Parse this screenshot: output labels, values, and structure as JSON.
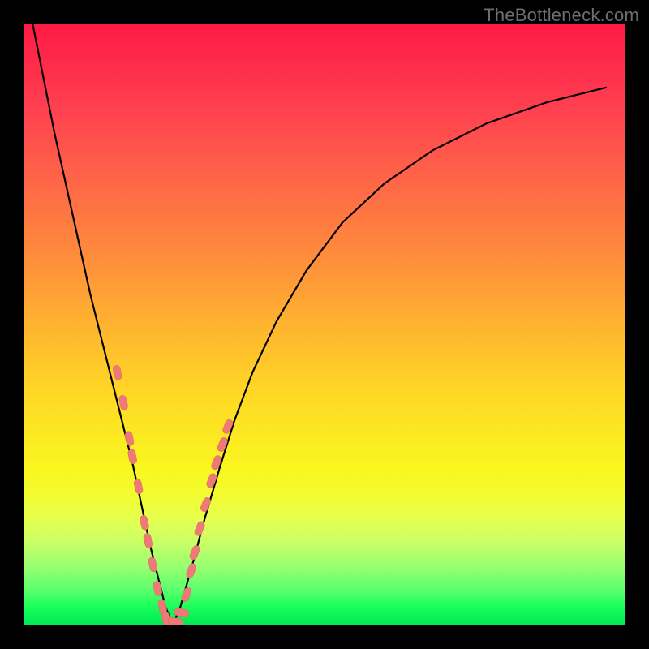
{
  "watermark": "TheBottleneck.com",
  "colors": {
    "background": "#000000",
    "gradient_top": "#ff1a45",
    "gradient_bottom": "#00e854",
    "curve": "#000000",
    "bead_fill": "#ee7a77",
    "bead_stroke": "#e06865"
  },
  "chart_data": {
    "type": "line",
    "title": "",
    "xlabel": "",
    "ylabel": "",
    "xlim": [
      0,
      100
    ],
    "ylim": [
      0,
      100
    ],
    "grid": false,
    "series": [
      {
        "name": "curve",
        "x": [
          1,
          3,
          5,
          7,
          9,
          11,
          13,
          15,
          16.5,
          18,
          19.5,
          21,
          22.25,
          23.5,
          24.75,
          26,
          28,
          30,
          32.5,
          35,
          38,
          42,
          47,
          53,
          60,
          68,
          77,
          87,
          97
        ],
        "values": [
          102,
          92,
          82,
          73,
          64,
          55,
          47,
          39,
          33,
          27,
          20,
          13,
          8,
          3,
          0,
          3,
          10,
          17.5,
          26,
          34,
          42,
          50.5,
          59,
          67,
          73.5,
          79,
          83.5,
          87,
          89.5
        ]
      }
    ],
    "annotations": {
      "beads_left": [
        {
          "x": 15.5,
          "y": 42
        },
        {
          "x": 16.5,
          "y": 37
        },
        {
          "x": 17.5,
          "y": 31
        },
        {
          "x": 18.0,
          "y": 28
        },
        {
          "x": 19.0,
          "y": 23
        },
        {
          "x": 20.0,
          "y": 17
        },
        {
          "x": 20.6,
          "y": 14
        },
        {
          "x": 21.4,
          "y": 10
        },
        {
          "x": 22.2,
          "y": 6
        },
        {
          "x": 23.0,
          "y": 3
        },
        {
          "x": 23.6,
          "y": 1
        }
      ],
      "beads_bottom": [
        {
          "x": 24.5,
          "y": 0
        },
        {
          "x": 25.2,
          "y": 0.5
        },
        {
          "x": 26.2,
          "y": 2
        }
      ],
      "beads_right": [
        {
          "x": 27.0,
          "y": 5
        },
        {
          "x": 27.8,
          "y": 9
        },
        {
          "x": 28.4,
          "y": 12
        },
        {
          "x": 29.2,
          "y": 16
        },
        {
          "x": 30.2,
          "y": 20
        },
        {
          "x": 31.2,
          "y": 24
        },
        {
          "x": 32.0,
          "y": 27
        },
        {
          "x": 33.0,
          "y": 30
        },
        {
          "x": 33.9,
          "y": 33
        }
      ]
    }
  }
}
